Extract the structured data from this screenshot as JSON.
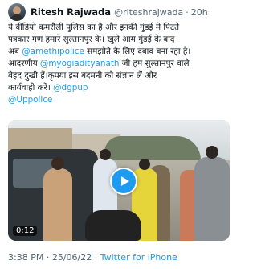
{
  "tweet": {
    "author_name": "Ritesh Rajwada",
    "handle": "@riteshrajwada",
    "separator": "·",
    "relative_time": "20h",
    "text_lines": [
      {
        "text": "ये वीडियो कमरौली पुलिस का है और इनकी गुंडई में पिटते"
      },
      {
        "text": "पत्रकार गण हमारे सुल्तानपुर के। खुले आम गुंडई के बाद"
      },
      {
        "pre": "अब ",
        "link": "@amethipolice",
        "post": " समझौते के लिए दबाव बना रहा है।"
      },
      {
        "pre": "आदरणीय ",
        "link": "@myogiadityanath",
        "post": " जी हम सुल्तानपुर वाले"
      },
      {
        "text": "बेहद दुखी हैं।कृपया इस बदमनी को संज्ञान लें और"
      },
      {
        "pre": "कार्यवाही करें। ",
        "link": "@dgpup",
        "post": ""
      },
      {
        "pre": "",
        "link": "@Uppolice",
        "post": ""
      }
    ],
    "media": {
      "duration": "0:12",
      "play_icon": "play-icon"
    },
    "footer": {
      "time": "3:38 PM",
      "separator1": " · ",
      "date": "25/06/22",
      "separator2": " · ",
      "source": "Twitter for iPhone"
    }
  },
  "colors": {
    "link": "#1d9bf0",
    "secondary_text": "#536471",
    "primary_text": "#0f1419"
  }
}
